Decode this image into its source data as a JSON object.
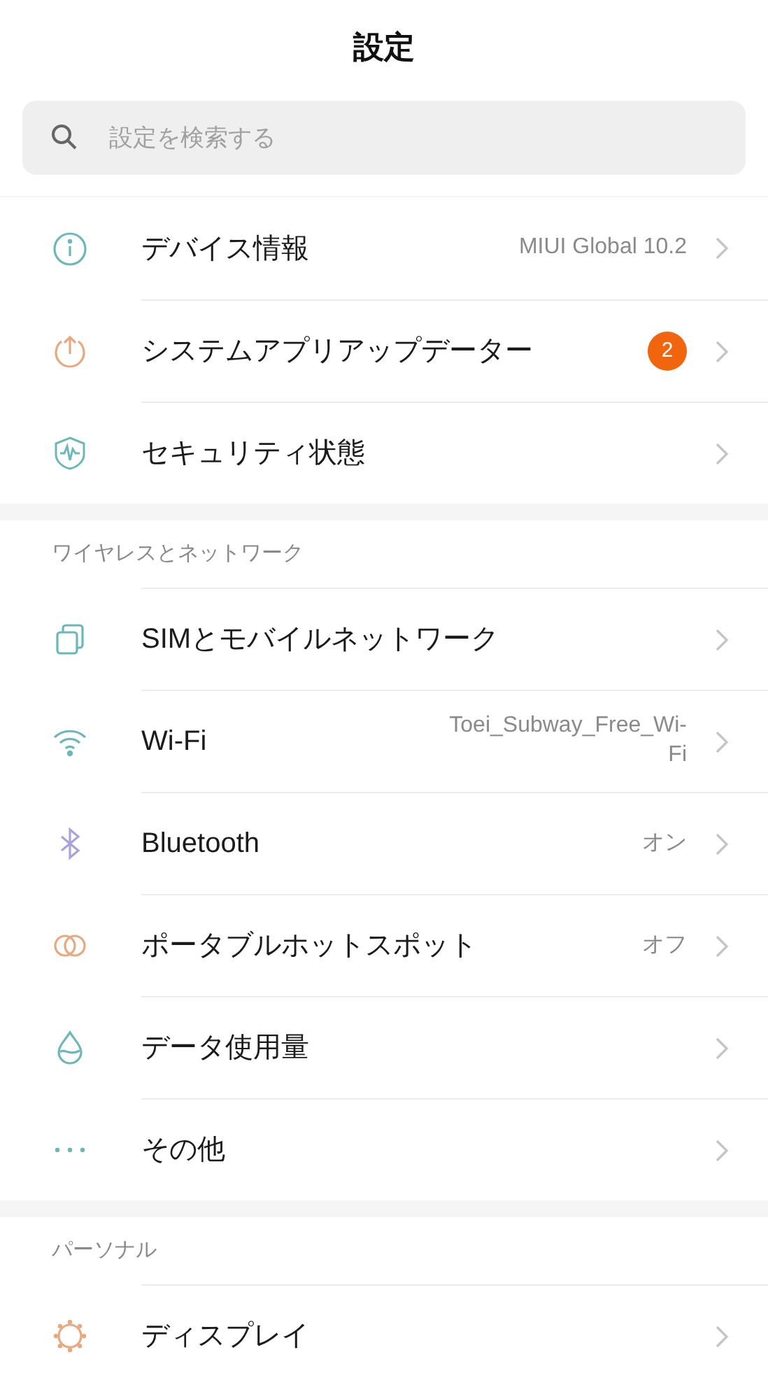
{
  "title": "設定",
  "search": {
    "placeholder": "設定を検索する"
  },
  "sections": [
    {
      "items": [
        {
          "label": "デバイス情報",
          "value": "MIUI Global 10.2"
        },
        {
          "label": "システムアプリアップデーター",
          "badge": "2"
        },
        {
          "label": "セキュリティ状態"
        }
      ]
    },
    {
      "header": "ワイヤレスとネットワーク",
      "items": [
        {
          "label": "SIMとモバイルネットワーク"
        },
        {
          "label": "Wi-Fi",
          "value": "Toei_Subway_Free_Wi-Fi"
        },
        {
          "label": "Bluetooth",
          "value": "オン"
        },
        {
          "label": "ポータブルホットスポット",
          "value": "オフ"
        },
        {
          "label": "データ使用量"
        },
        {
          "label": "その他"
        }
      ]
    },
    {
      "header": "パーソナル",
      "items": [
        {
          "label": "ディスプレイ"
        }
      ]
    }
  ]
}
